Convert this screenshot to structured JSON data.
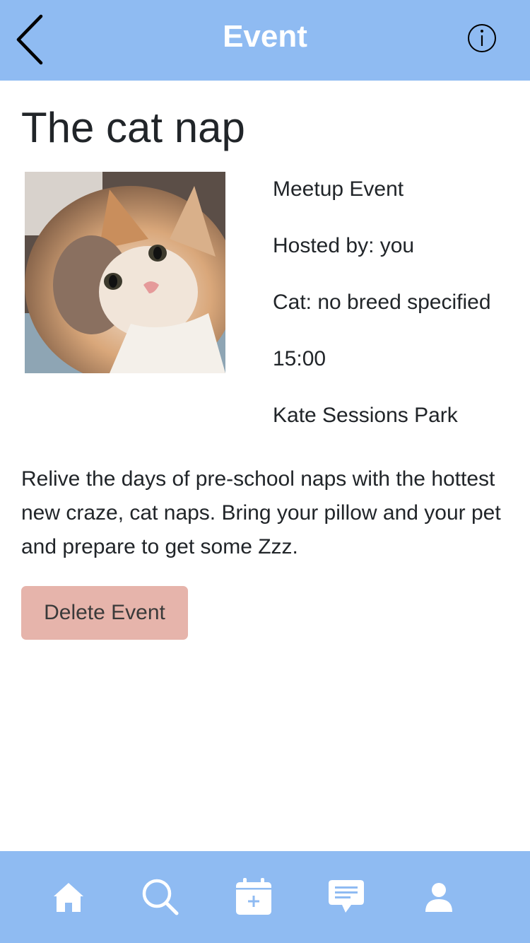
{
  "header": {
    "title": "Event",
    "back_icon": "chevron-left-icon",
    "info_icon": "info-icon"
  },
  "event": {
    "title": "The cat nap",
    "details": [
      "Meetup Event",
      "Hosted by: you",
      "Cat: no breed specified",
      "15:00",
      "Kate Sessions Park"
    ],
    "description": "Relive the days of pre-school naps with the hottest new craze, cat naps. Bring your pillow and your pet and prepare to get some Zzz.",
    "delete_label": "Delete Event"
  },
  "tabbar": {
    "items": [
      "home-icon",
      "search-icon",
      "calendar-add-icon",
      "chat-icon",
      "profile-icon"
    ]
  },
  "colors": {
    "accent": "#8fbbf2",
    "delete_button": "#e6b4ab",
    "text": "#212529"
  }
}
